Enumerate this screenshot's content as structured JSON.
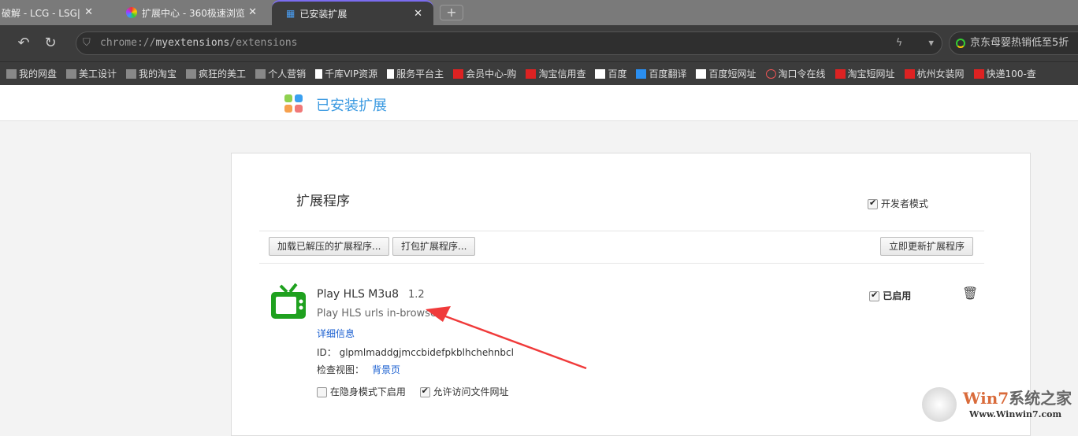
{
  "tabs": [
    {
      "label": "破解 - LCG - LSG|"
    },
    {
      "label": "扩展中心 - 360极速浏览"
    },
    {
      "label": "已安装扩展"
    }
  ],
  "address": {
    "scheme": "chrome://",
    "host": "myextensions",
    "path": "/extensions"
  },
  "search": {
    "text": "京东母婴热销低至5折"
  },
  "bookmarks": [
    {
      "label": "我的网盘",
      "icon": "folder-icon"
    },
    {
      "label": "美工设计",
      "icon": "folder-icon"
    },
    {
      "label": "我的淘宝",
      "icon": "folder-icon"
    },
    {
      "label": "疯狂的美工",
      "icon": "folder-icon"
    },
    {
      "label": "个人营销",
      "icon": "folder-icon"
    },
    {
      "label": "千库VIP资源",
      "icon": "page-icon"
    },
    {
      "label": "服务平台主",
      "icon": "page-icon"
    },
    {
      "label": "会员中心-购",
      "icon": "site-icon"
    },
    {
      "label": "淘宝信用查",
      "icon": "site-icon"
    },
    {
      "label": "百度",
      "icon": "baidu-icon"
    },
    {
      "label": "百度翻译",
      "icon": "translate-icon"
    },
    {
      "label": "百度短网址",
      "icon": "baidu-icon"
    },
    {
      "label": "淘口令在线",
      "icon": "owl-icon"
    },
    {
      "label": "淘宝短网址",
      "icon": "site-icon"
    },
    {
      "label": "杭州女装网",
      "icon": "site-icon"
    },
    {
      "label": "快递100-查",
      "icon": "site-icon"
    }
  ],
  "page": {
    "title": "已安装扩展"
  },
  "card": {
    "title": "扩展程序",
    "dev_mode": "开发者模式",
    "load_unpacked": "加载已解压的扩展程序...",
    "pack": "打包扩展程序...",
    "update": "立即更新扩展程序"
  },
  "extension": {
    "name": "Play HLS M3u8",
    "version": "1.2",
    "description": "Play HLS urls in-browser",
    "details": "详细信息",
    "id_label": "ID：",
    "id": "glpmlmaddgjmccbidefpkblhchehnbcl",
    "inspect_label": "检查视图：",
    "inspect_link": "背景页",
    "incognito": "在隐身模式下启用",
    "file_access": "允许访问文件网址",
    "enabled": "已启用"
  },
  "watermark": {
    "brand": "Win7系统之家",
    "url": "Www.Winwin7.com"
  }
}
